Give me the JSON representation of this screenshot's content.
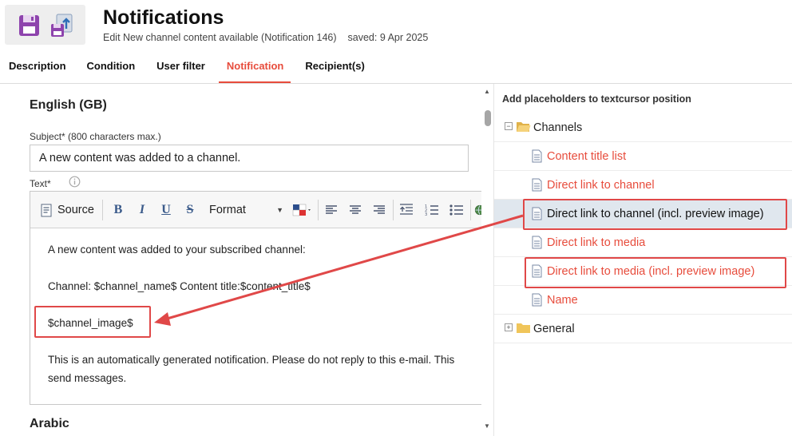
{
  "header": {
    "title": "Notifications",
    "subtitle": "Edit New channel content available (Notification 146)",
    "saved": "saved: 9 Apr 2025"
  },
  "tabs": [
    {
      "label": "Description",
      "active": false
    },
    {
      "label": "Condition",
      "active": false
    },
    {
      "label": "User filter",
      "active": false
    },
    {
      "label": "Notification",
      "active": true
    },
    {
      "label": "Recipient(s)",
      "active": false
    }
  ],
  "editor_section": {
    "language": "English (GB)",
    "subject_label": "Subject* (800 characters max.)",
    "subject_value": "A new content was added to a channel.",
    "text_label": "Text*",
    "toolbar": {
      "source_label": "Source",
      "bold": "B",
      "italic": "I",
      "underline": "U",
      "strike": "S",
      "format_label": "Format"
    },
    "content": {
      "line1": "A new content was added to your subscribed channel:",
      "line2": "Channel: $channel_name$ Content title:$content_title$",
      "line3": "$channel_image$",
      "line4": "This is an automatically generated notification. Please do not reply to this e-mail. This",
      "line5": "send messages."
    },
    "next_language": "Arabic"
  },
  "placeholders": {
    "header": "Add placeholders to textcursor position",
    "channels_group": "Channels",
    "items": [
      "Content title list",
      "Direct link to channel",
      "Direct link to channel (incl. preview image)",
      "Direct link to media",
      "Direct link to media (incl. preview image)",
      "Name"
    ],
    "general_group": "General"
  },
  "colors": {
    "accent": "#e74c3c",
    "highlight": "#e04848",
    "selected_row": "#e0e7ee",
    "toolbar_bg": "#f7f7f7"
  }
}
